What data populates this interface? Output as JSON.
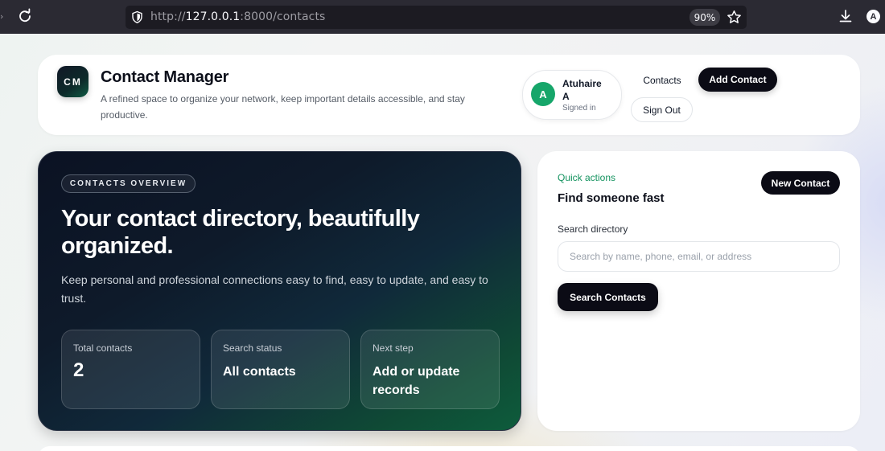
{
  "browser": {
    "url_prefix": "http://",
    "url_host": "127.0.0.1",
    "url_rest": ":8000/contacts",
    "zoom": "90%",
    "account_initial": "A",
    "side_arrow": "›"
  },
  "header": {
    "logo_text": "CM",
    "title": "Contact Manager",
    "subtitle": "A refined space to organize your network, keep important details accessible, and stay productive.",
    "user": {
      "initial": "A",
      "name": "Atuhaire A",
      "status": "Signed in"
    },
    "nav_contacts": "Contacts",
    "add_contact": "Add Contact",
    "sign_out": "Sign Out"
  },
  "hero": {
    "eyebrow": "CONTACTS OVERVIEW",
    "title": "Your contact directory, beautifully organized.",
    "description": "Keep personal and professional connections easy to find, easy to update, and easy to trust.",
    "stats": [
      {
        "label": "Total contacts",
        "value": "2"
      },
      {
        "label": "Search status",
        "value": "All contacts"
      },
      {
        "label": "Next step",
        "value": "Add or update records"
      }
    ]
  },
  "quick_actions": {
    "eyebrow": "Quick actions",
    "title": "Find someone fast",
    "new_contact": "New Contact",
    "search_label": "Search directory",
    "search_placeholder": "Search by name, phone, email, or address",
    "search_value": "",
    "search_button": "Search Contacts"
  },
  "colors": {
    "accent_green": "#14935f",
    "avatar_green": "#16a66a",
    "button_dark": "#0b0b15",
    "chrome_bg": "#2b2a33"
  }
}
